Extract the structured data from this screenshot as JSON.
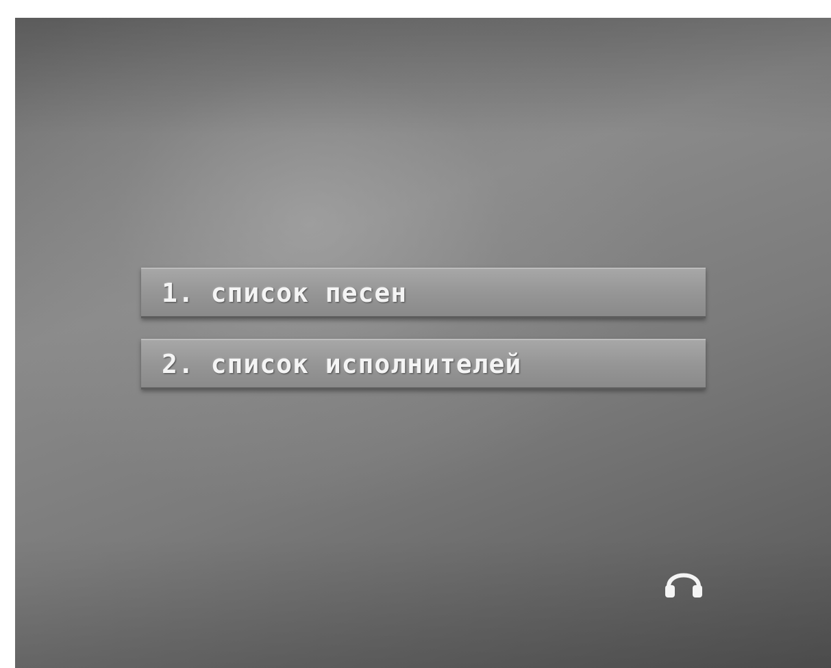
{
  "menu": {
    "items": [
      {
        "label": "1. список песен"
      },
      {
        "label": "2. список исполнителей"
      }
    ]
  },
  "status": {
    "icon": "headphones-icon"
  },
  "colors": {
    "background": "#7b7b7b",
    "menu_item": "#969696",
    "text": "#f4f4f4"
  }
}
